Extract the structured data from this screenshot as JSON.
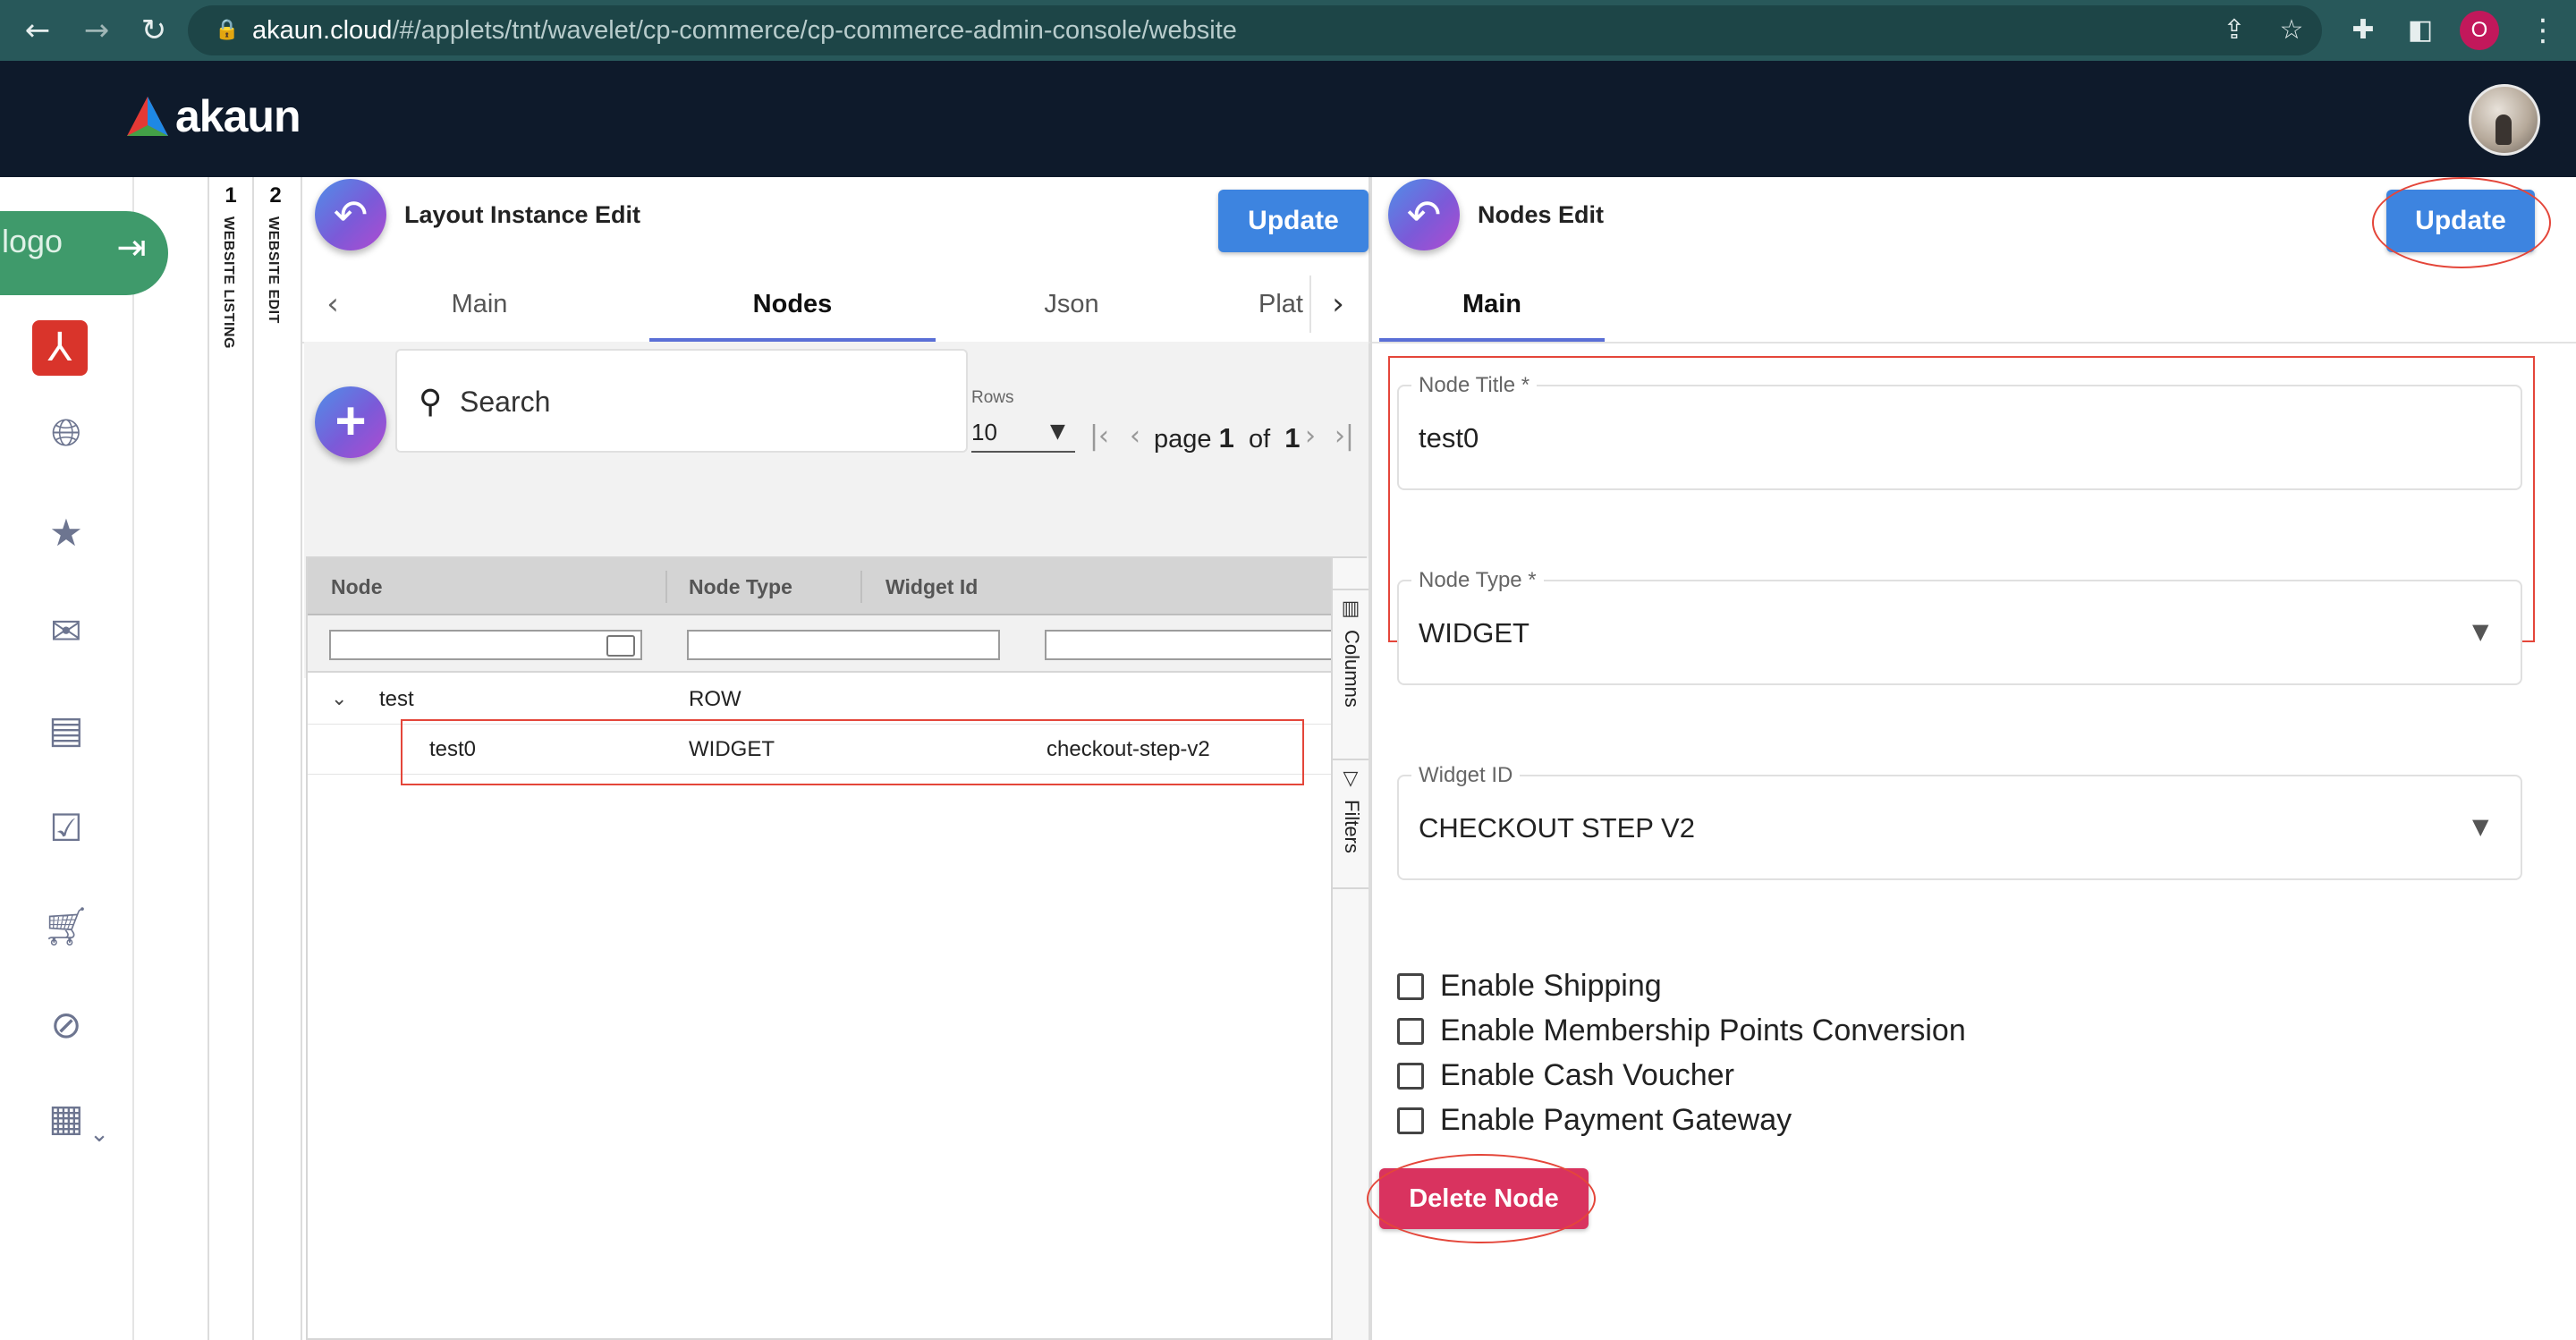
{
  "browser": {
    "url_host": "akaun.cloud",
    "url_path": "/#/applets/tnt/wavelet/cp-commerce/cp-commerce-admin-console/website",
    "profile_initial": "O"
  },
  "app": {
    "brand": "akaun"
  },
  "sidebar": {
    "logo_alt": "logo"
  },
  "rails": [
    {
      "number": "1",
      "label": "WEBSITE LISTING"
    },
    {
      "number": "2",
      "label": "WEBSITE EDIT"
    }
  ],
  "left_panel": {
    "title": "Layout Instance Edit",
    "update_label": "Update",
    "tabs": [
      "Main",
      "Nodes",
      "Json",
      "Plat"
    ],
    "active_tab": "Nodes",
    "search_placeholder": "Search",
    "rows_label": "Rows",
    "rows_value": "10",
    "pager": {
      "page_word": "page",
      "page": "1",
      "of_word": "of",
      "total": "1"
    },
    "grid": {
      "columns": [
        "Node",
        "Node Type",
        "Widget Id"
      ],
      "rows": [
        {
          "node": "test",
          "type": "ROW",
          "widget": ""
        },
        {
          "node": "test0",
          "type": "WIDGET",
          "widget": "checkout-step-v2"
        }
      ],
      "side_tools": [
        "Columns",
        "Filters"
      ]
    }
  },
  "right_panel": {
    "title": "Nodes Edit",
    "update_label": "Update",
    "tabs": [
      "Main"
    ],
    "fields": {
      "node_title": {
        "label": "Node Title *",
        "value": "test0"
      },
      "node_type": {
        "label": "Node Type *",
        "value": "WIDGET"
      },
      "widget_id": {
        "label": "Widget ID",
        "value": "CHECKOUT STEP V2"
      }
    },
    "checkboxes": [
      "Enable Shipping",
      "Enable Membership Points Conversion",
      "Enable Cash Voucher",
      "Enable Payment Gateway"
    ],
    "delete_label": "Delete Node"
  },
  "colors": {
    "browser_bar": "#28585a",
    "app_header": "#0e1a2b",
    "primary_button": "#3d84e0",
    "delete_button": "#d9335f",
    "annotation_red": "#e4463a",
    "login_tab": "#3f9a6b"
  }
}
